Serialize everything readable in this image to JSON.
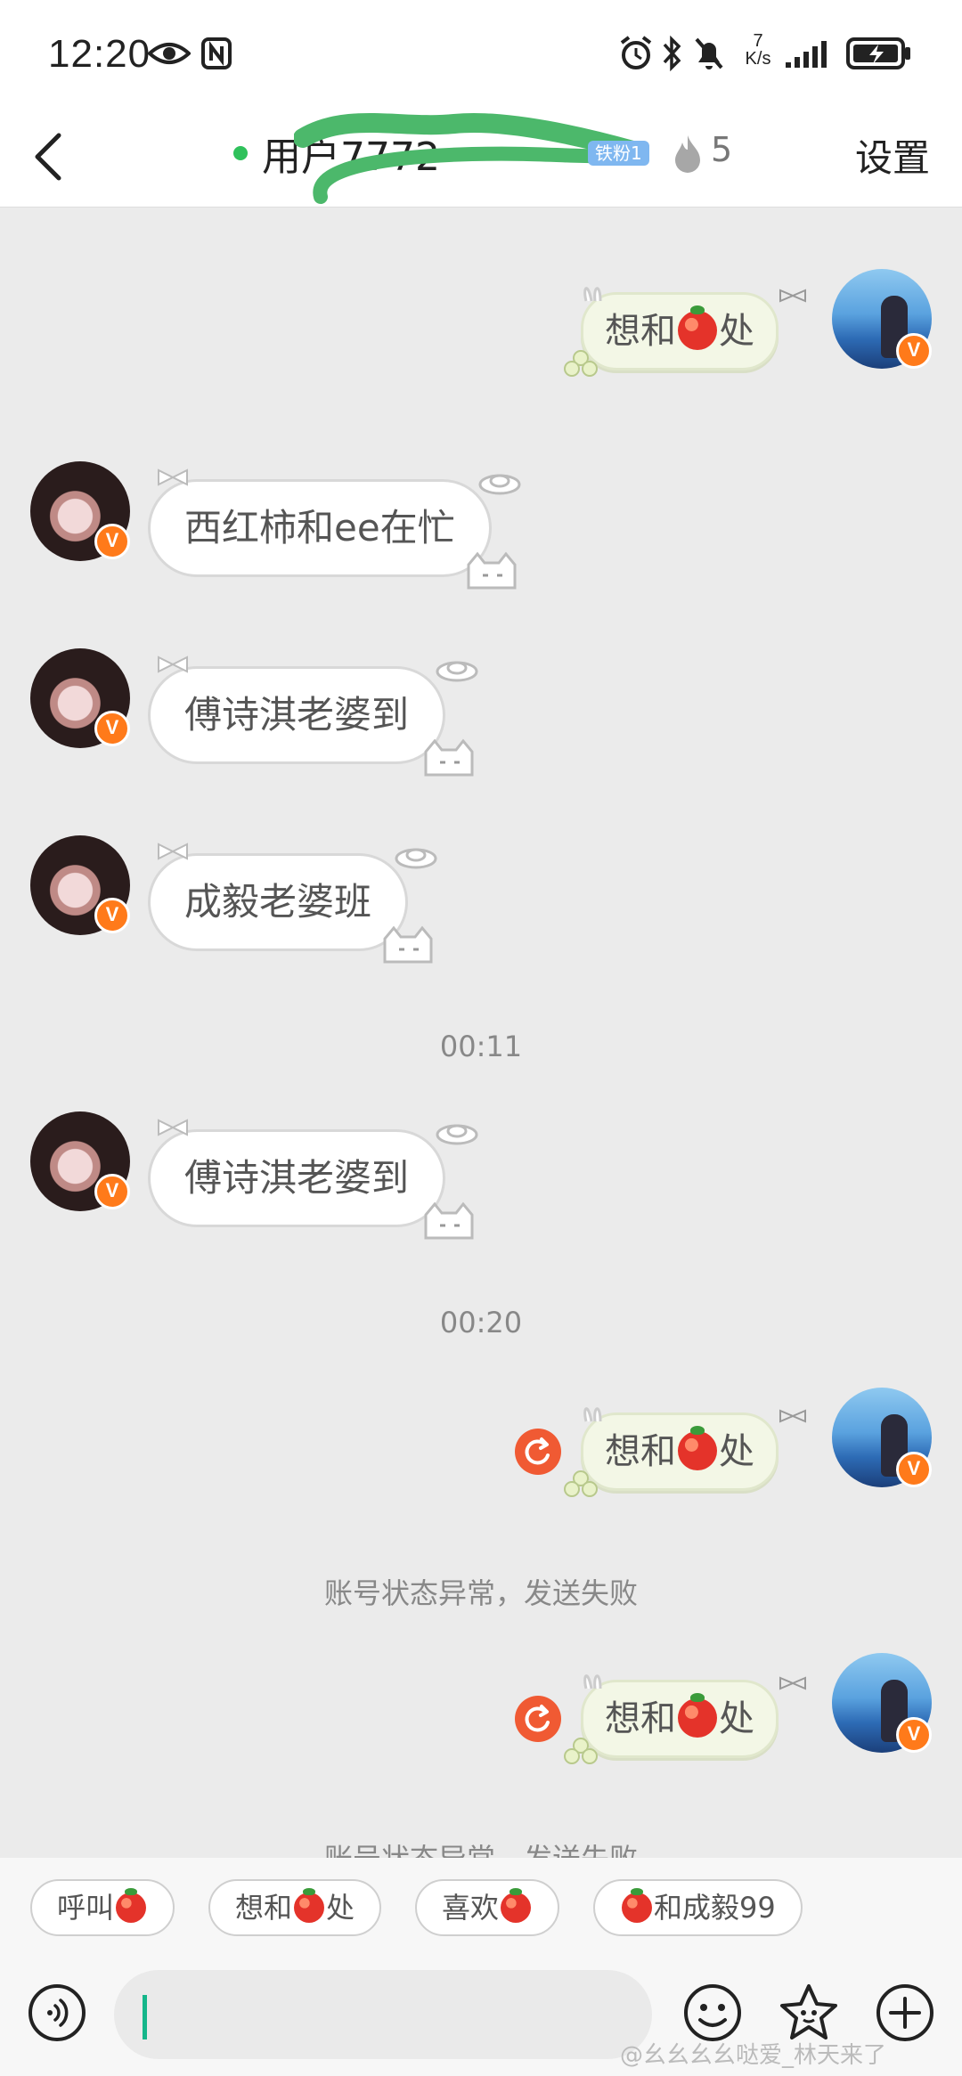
{
  "status_bar": {
    "time": "12:20",
    "speed": "7",
    "speed_unit": "K/s"
  },
  "header": {
    "title": "用户7772",
    "fan_badge": "铁粉1",
    "heat": "5",
    "settings": "设置"
  },
  "messages": [
    {
      "text_before": "想和",
      "text_after": "处"
    },
    {
      "text": "西红柿和ee在忙"
    },
    {
      "text": "傅诗淇老婆到"
    },
    {
      "text": "成毅老婆班"
    },
    {
      "time": "00:11"
    },
    {
      "text": "傅诗淇老婆到"
    },
    {
      "time": "00:20"
    },
    {
      "text_before": "想和",
      "text_after": "处"
    },
    {
      "note": "账号状态异常，发送失败"
    },
    {
      "text_before": "想和",
      "text_after": "处"
    },
    {
      "note": "账号状态异常，发送失败"
    }
  ],
  "avatar_badge": "V",
  "quick_replies": {
    "chip1": "呼叫",
    "chip2_before": "想和",
    "chip2_after": "处",
    "chip3": "喜欢",
    "chip4": "和成毅99"
  },
  "watermark": "@幺幺幺幺哒爱_林天来了",
  "colors": {
    "online": "#2fc15b",
    "verified_badge": "#ff7a1a",
    "retry": "#f05a33",
    "caret": "#15b68a"
  }
}
